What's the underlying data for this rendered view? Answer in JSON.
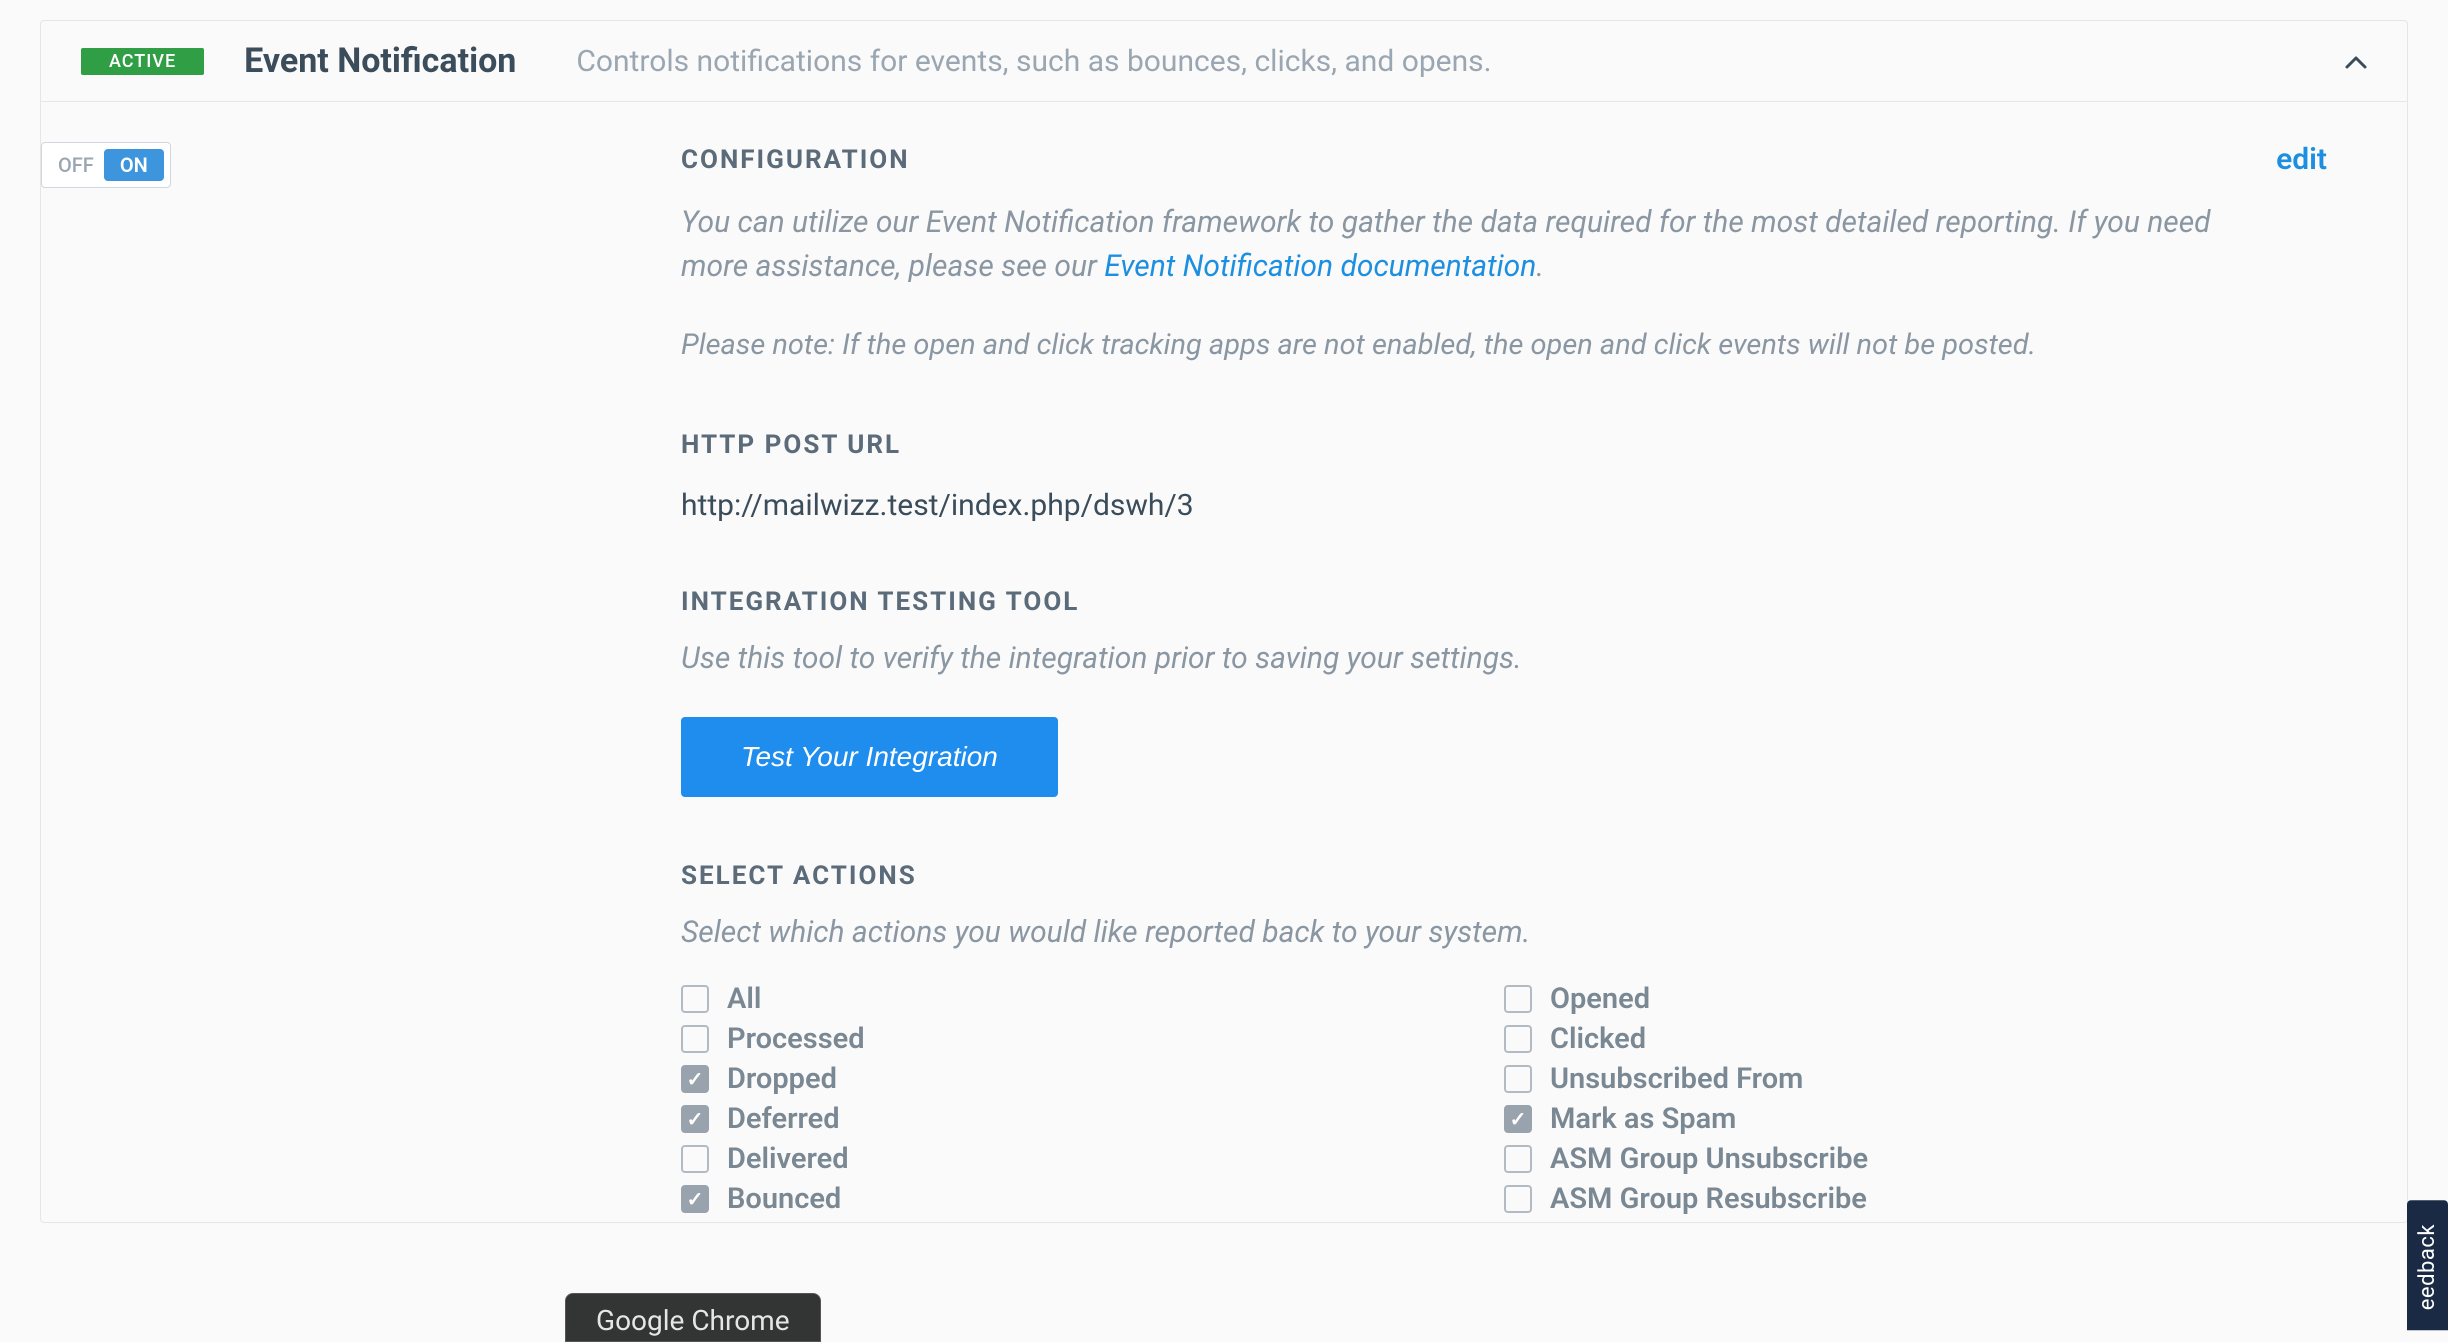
{
  "header": {
    "badge": "ACTIVE",
    "title": "Event Notification",
    "subtitle": "Controls notifications for events, such as bounces, clicks, and opens."
  },
  "toggle": {
    "off": "OFF",
    "on": "ON"
  },
  "config": {
    "label": "CONFIGURATION",
    "edit": "edit",
    "desc_pre": "You can utilize our Event Notification framework to gather the data required for the most detailed reporting. If you need more assistance, please see our ",
    "desc_link": "Event Notification documentation",
    "desc_post": ".",
    "note": "Please note: If the open and click tracking apps are not enabled, the open and click events will not be posted."
  },
  "http": {
    "label": "HTTP POST URL",
    "value": "http://mailwizz.test/index.php/dswh/3"
  },
  "testing": {
    "label": "INTEGRATION TESTING TOOL",
    "desc": "Use this tool to verify the integration prior to saving your settings.",
    "button": "Test Your Integration"
  },
  "actions": {
    "label": "SELECT ACTIONS",
    "desc": "Select which actions you would like reported back to your system.",
    "left": [
      {
        "label": "All",
        "checked": false
      },
      {
        "label": "Processed",
        "checked": false
      },
      {
        "label": "Dropped",
        "checked": true
      },
      {
        "label": "Deferred",
        "checked": true
      },
      {
        "label": "Delivered",
        "checked": false
      },
      {
        "label": "Bounced",
        "checked": true
      }
    ],
    "right": [
      {
        "label": "Opened",
        "checked": false
      },
      {
        "label": "Clicked",
        "checked": false
      },
      {
        "label": "Unsubscribed From",
        "checked": false
      },
      {
        "label": "Mark as Spam",
        "checked": true
      },
      {
        "label": "ASM Group Unsubscribe",
        "checked": false
      },
      {
        "label": "ASM Group Resubscribe",
        "checked": false
      }
    ]
  },
  "feedback": "eedback",
  "taskbar": "Google Chrome"
}
